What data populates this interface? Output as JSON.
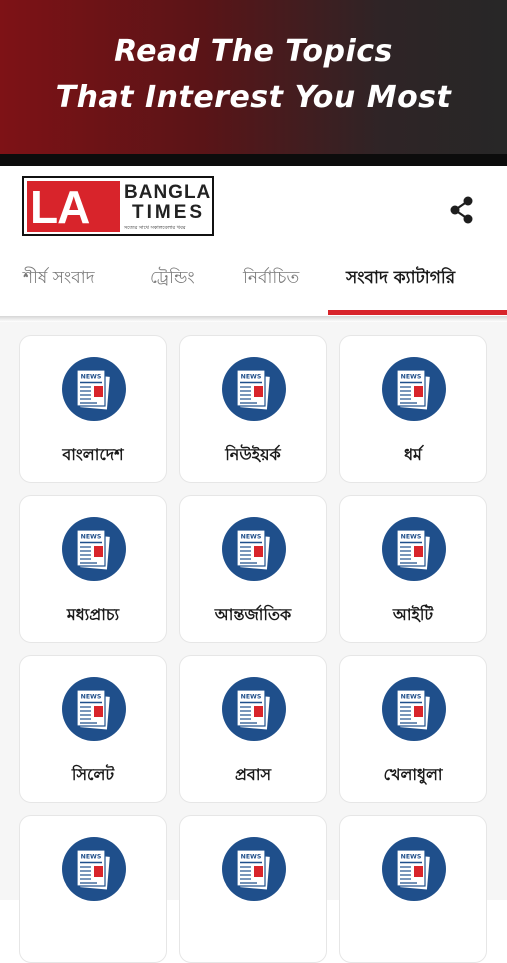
{
  "promo": {
    "line1": "Read The Topics",
    "line2": "That Interest You Most"
  },
  "app": {
    "logo": {
      "mark": "LA",
      "line1": "BANGLA",
      "line2": "TIMES",
      "tagline": "সত্যের সাথে সকালবেলার খবর"
    },
    "share_icon": "share-icon"
  },
  "tabs": [
    {
      "label": "শীর্ষ সংবাদ",
      "active": false
    },
    {
      "label": "ট্রেন্ডিং",
      "active": false
    },
    {
      "label": "নির্বাচিত",
      "active": false
    },
    {
      "label": "সংবাদ ক্যাটাগরি",
      "active": true
    }
  ],
  "colors": {
    "accent": "#d8242b",
    "icon_bg": "#1f4f8b",
    "promo_start": "#7e1216",
    "promo_end": "#272727"
  },
  "icon_text": "NEWS",
  "categories": [
    {
      "label": "বাংলাদেশ"
    },
    {
      "label": "নিউইয়র্ক"
    },
    {
      "label": "ধর্ম"
    },
    {
      "label": "মধ্যপ্রাচ্য"
    },
    {
      "label": "আন্তর্জাতিক"
    },
    {
      "label": "আইটি"
    },
    {
      "label": "সিলেট"
    },
    {
      "label": "প্রবাস"
    },
    {
      "label": "খেলাধুলা"
    },
    {
      "label": ""
    },
    {
      "label": ""
    },
    {
      "label": ""
    }
  ]
}
